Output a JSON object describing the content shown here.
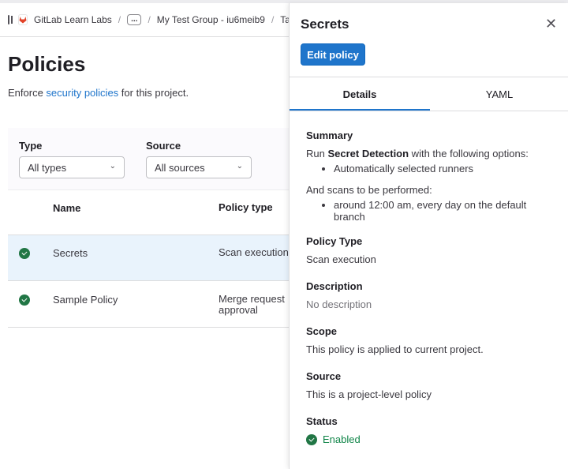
{
  "breadcrumb": {
    "items": [
      "GitLab Learn Labs",
      "...",
      "My Test Group - iu6meib9",
      "Ta"
    ]
  },
  "page": {
    "title": "Policies",
    "subtitle_before": "Enforce ",
    "subtitle_link": "security policies",
    "subtitle_after": " for this project."
  },
  "filters": {
    "type_label": "Type",
    "type_value": "All types",
    "source_label": "Source",
    "source_value": "All sources"
  },
  "table": {
    "headers": [
      "Name",
      "Policy type"
    ],
    "rows": [
      {
        "name": "Secrets",
        "type": "Scan execution",
        "status": "enabled",
        "selected": true
      },
      {
        "name": "Sample Policy",
        "type": "Merge request approval",
        "status": "enabled",
        "selected": false
      }
    ]
  },
  "drawer": {
    "title": "Secrets",
    "edit_label": "Edit policy",
    "tabs": [
      "Details",
      "YAML"
    ],
    "summary": {
      "heading": "Summary",
      "run_prefix": "Run ",
      "run_bold": "Secret Detection",
      "run_suffix": " with the following options:",
      "options": [
        "Automatically selected runners"
      ],
      "scans_label": "And scans to be performed:",
      "scans": [
        "around 12:00 am, every day on the default branch"
      ]
    },
    "policy_type": {
      "heading": "Policy Type",
      "value": "Scan execution"
    },
    "description": {
      "heading": "Description",
      "value": "No description"
    },
    "scope": {
      "heading": "Scope",
      "value": "This policy is applied to current project."
    },
    "source": {
      "heading": "Source",
      "value": "This is a project-level policy"
    },
    "status": {
      "heading": "Status",
      "value": "Enabled"
    }
  },
  "colors": {
    "accent": "#1f75cb",
    "success": "#108548",
    "selected_row": "#e9f3fc"
  }
}
